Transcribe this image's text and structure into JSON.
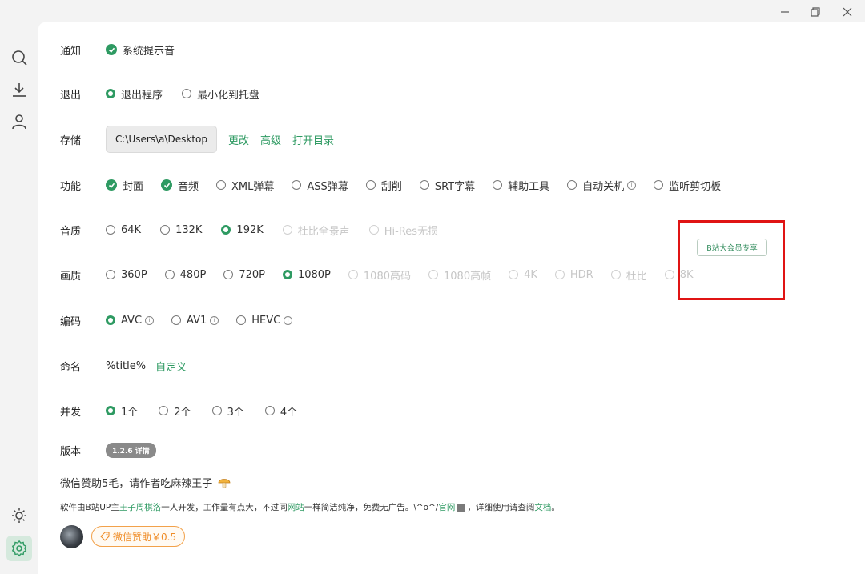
{
  "window": {
    "minimize": "—",
    "restore": "❐",
    "close": "✕"
  },
  "sidebar": {
    "items": [
      {
        "name": "search",
        "icon": "search-icon"
      },
      {
        "name": "download",
        "icon": "download-icon"
      },
      {
        "name": "user",
        "icon": "user-icon"
      },
      {
        "name": "theme",
        "icon": "sun-icon"
      },
      {
        "name": "settings",
        "icon": "gear-icon",
        "active": true
      }
    ]
  },
  "settings": {
    "notify": {
      "label": "通知",
      "options": [
        {
          "text": "系统提示音",
          "checked": true
        }
      ]
    },
    "exit": {
      "label": "退出",
      "options": [
        {
          "text": "退出程序",
          "selected": true
        },
        {
          "text": "最小化到托盘",
          "selected": false
        }
      ]
    },
    "storage": {
      "label": "存储",
      "path": "C:\\Users\\a\\Desktop",
      "links": [
        "更改",
        "高级",
        "打开目录"
      ]
    },
    "features": {
      "label": "功能",
      "options": [
        {
          "text": "封面",
          "checked": true
        },
        {
          "text": "音频",
          "checked": true
        },
        {
          "text": "XML弹幕",
          "checked": false
        },
        {
          "text": "ASS弹幕",
          "checked": false
        },
        {
          "text": "刮削",
          "checked": false
        },
        {
          "text": "SRT字幕",
          "checked": false
        },
        {
          "text": "辅助工具",
          "checked": false
        },
        {
          "text": "自动关机",
          "checked": false
        },
        {
          "text": "监听剪切板",
          "checked": false
        }
      ]
    },
    "audio": {
      "label": "音质",
      "options": [
        {
          "text": "64K",
          "selected": false,
          "disabled": false
        },
        {
          "text": "132K",
          "selected": false,
          "disabled": false
        },
        {
          "text": "192K",
          "selected": true,
          "disabled": false
        },
        {
          "text": "杜比全景声",
          "selected": false,
          "disabled": true
        },
        {
          "text": "Hi-Res无损",
          "selected": false,
          "disabled": true
        }
      ]
    },
    "video": {
      "label": "画质",
      "options": [
        {
          "text": "360P",
          "selected": false,
          "disabled": false
        },
        {
          "text": "480P",
          "selected": false,
          "disabled": false
        },
        {
          "text": "720P",
          "selected": false,
          "disabled": false
        },
        {
          "text": "1080P",
          "selected": true,
          "disabled": false
        },
        {
          "text": "1080高码",
          "selected": false,
          "disabled": true
        },
        {
          "text": "1080高帧",
          "selected": false,
          "disabled": true
        },
        {
          "text": "4K",
          "selected": false,
          "disabled": true
        },
        {
          "text": "HDR",
          "selected": false,
          "disabled": true
        },
        {
          "text": "杜比",
          "selected": false,
          "disabled": true
        },
        {
          "text": "8K",
          "selected": false,
          "disabled": true
        }
      ],
      "vip_badge": "B站大会员专享"
    },
    "codec": {
      "label": "编码",
      "options": [
        {
          "text": "AVC",
          "selected": true
        },
        {
          "text": "AV1",
          "selected": false
        },
        {
          "text": "HEVC",
          "selected": false
        }
      ]
    },
    "naming": {
      "label": "命名",
      "value": "%title%",
      "link": "自定义"
    },
    "concurrency": {
      "label": "并发",
      "options": [
        {
          "text": "1个",
          "selected": true
        },
        {
          "text": "2个",
          "selected": false
        },
        {
          "text": "3个",
          "selected": false
        },
        {
          "text": "4个",
          "selected": false
        }
      ]
    },
    "version": {
      "label": "版本",
      "badge": "1.2.6 详情"
    }
  },
  "footer": {
    "sponsor_line": "微信赞助5毛，请作者吃麻辣王子",
    "desc_prefix": "软件由B站UP主",
    "author": "王子周棋洛",
    "desc_mid1": "一人开发，工作量有点大，不过同",
    "site": "网站",
    "desc_mid2": "一样简洁纯净，免费无广告。\\^o^/",
    "official": "官网",
    "desc_mid3": "，详细使用请查阅",
    "docs": "文档",
    "desc_end": "。",
    "donate_button": "微信赞助￥0.5"
  },
  "colors": {
    "accent": "#2e9a62",
    "highlight": "#e01414",
    "donate": "#ef8b25"
  }
}
